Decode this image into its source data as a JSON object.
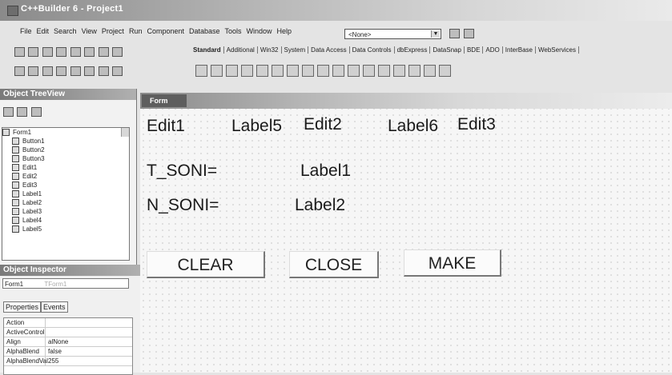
{
  "window": {
    "title": "C++Builder 6 - Project1"
  },
  "menu": [
    "File",
    "Edit",
    "Search",
    "View",
    "Project",
    "Run",
    "Component",
    "Database",
    "Tools",
    "Window",
    "Help"
  ],
  "toolbar": {
    "combo_value": "<None>"
  },
  "palette_tabs": [
    "Standard",
    "Additional",
    "Win32",
    "System",
    "Data Access",
    "Data Controls",
    "dbExpress",
    "DataSnap",
    "BDE",
    "ADO",
    "InterBase",
    "WebServices"
  ],
  "tree_view": {
    "title": "Object TreeView",
    "items": [
      "Form1",
      "Button1",
      "Button2",
      "Button3",
      "Edit1",
      "Edit2",
      "Edit3",
      "Label1",
      "Label2",
      "Label3",
      "Label4",
      "Label5"
    ]
  },
  "inspector": {
    "title": "Object Inspector",
    "object": "Form1",
    "object_type": "TForm1",
    "tabs": [
      "Properties",
      "Events"
    ],
    "rows": [
      {
        "name": "Action",
        "value": ""
      },
      {
        "name": "ActiveControl",
        "value": ""
      },
      {
        "name": "Align",
        "value": "alNone"
      },
      {
        "name": "AlphaBlend",
        "value": "false"
      },
      {
        "name": "AlphaBlendVal",
        "value": "255"
      }
    ]
  },
  "form": {
    "title": "Form",
    "controls": {
      "edit1": "Edit1",
      "label5": "Label5",
      "edit2": "Edit2",
      "label6": "Label6",
      "edit3": "Edit3",
      "t_soni": "T_SONI=",
      "label1": "Label1",
      "n_soni": "N_SONI=",
      "label2": "Label2"
    },
    "buttons": {
      "clear": "CLEAR",
      "close": "CLOSE",
      "make": "MAKE"
    }
  }
}
